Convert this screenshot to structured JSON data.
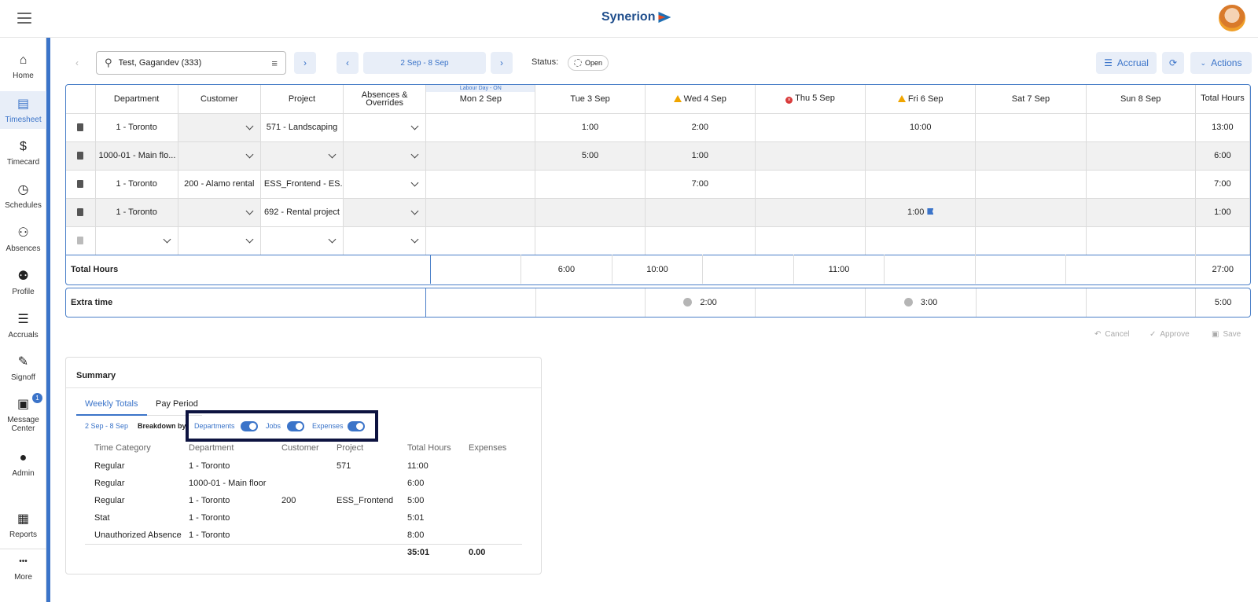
{
  "header": {
    "brand": "Synerion"
  },
  "nav": [
    {
      "label": "Home",
      "icon": "home-icon",
      "glyph": "⌂"
    },
    {
      "label": "Timesheet",
      "icon": "document-icon",
      "glyph": "▤"
    },
    {
      "label": "Timecard",
      "icon": "dollar-icon",
      "glyph": "$"
    },
    {
      "label": "Schedules",
      "icon": "clock-icon",
      "glyph": "◷"
    },
    {
      "label": "Absences",
      "icon": "person-remove-icon",
      "glyph": "⚇"
    },
    {
      "label": "Profile",
      "icon": "people-icon",
      "glyph": "⚉"
    },
    {
      "label": "Accruals",
      "icon": "list-icon",
      "glyph": "☰"
    },
    {
      "label": "Signoff",
      "icon": "signature-icon",
      "glyph": "✎"
    },
    {
      "label1": "Message",
      "label2": "Center",
      "badge": "1",
      "icon": "chat-icon",
      "glyph": "▣"
    },
    {
      "label": "Admin",
      "icon": "person-icon",
      "glyph": "●"
    },
    {
      "label": "Reports",
      "icon": "files-icon",
      "glyph": "▦"
    },
    {
      "label": "More",
      "icon": "more-icon",
      "glyph": "•••"
    }
  ],
  "toolbar": {
    "search_value": "Test, Gagandev (333)",
    "date_range": "2 Sep - 8 Sep",
    "status_label": "Status:",
    "status_value": "Open",
    "accrual": "Accrual",
    "actions": "Actions"
  },
  "grid": {
    "headers": [
      "Department",
      "Customer",
      "Project",
      "Absences & Overrides"
    ],
    "holiday": "Labour Day - ON",
    "days": [
      "Mon 2 Sep",
      "Tue 3 Sep",
      "Wed 4 Sep",
      "Thu 5 Sep",
      "Fri 6 Sep",
      "Sat 7 Sep",
      "Sun 8 Sep"
    ],
    "total_header": "Total Hours",
    "rows": [
      {
        "dept": "1 - Toronto",
        "cust": "",
        "proj": "571 - Landscaping",
        "abs": "",
        "d": [
          "",
          "1:00",
          "2:00",
          "",
          "10:00",
          "",
          ""
        ],
        "total": "13:00"
      },
      {
        "dept": "1000-01 - Main flo...",
        "cust": "",
        "proj": "",
        "abs": "",
        "d": [
          "",
          "5:00",
          "1:00",
          "",
          "",
          "",
          ""
        ],
        "total": "6:00"
      },
      {
        "dept": "1 - Toronto",
        "cust": "200 - Alamo rental",
        "proj": "ESS_Frontend - ES...",
        "abs": "",
        "d": [
          "",
          "",
          "7:00",
          "",
          "",
          "",
          ""
        ],
        "total": "7:00"
      },
      {
        "dept": "1 - Toronto",
        "cust": "",
        "proj": "692 - Rental project",
        "abs": "",
        "d": [
          "",
          "",
          "",
          "",
          "1:00",
          "",
          ""
        ],
        "total": "1:00"
      }
    ],
    "total_row": {
      "label": "Total Hours",
      "d": [
        "",
        "6:00",
        "10:00",
        "",
        "11:00",
        "",
        "",
        ""
      ],
      "total": "27:00"
    },
    "extra_row": {
      "label": "Extra time",
      "wed": "2:00",
      "fri": "3:00",
      "total": "5:00"
    }
  },
  "actions": {
    "cancel": "Cancel",
    "approve": "Approve",
    "save": "Save"
  },
  "summary": {
    "title": "Summary",
    "tabs": [
      "Weekly Totals",
      "Pay Period"
    ],
    "range": "2 Sep - 8 Sep",
    "breakdown": "Breakdown by:",
    "toggles": [
      "Departments",
      "Jobs",
      "Expenses"
    ],
    "columns": [
      "Time Category",
      "Department",
      "Customer",
      "Project",
      "Total Hours",
      "Expenses"
    ],
    "rows": [
      [
        "Regular",
        "1 - Toronto",
        "",
        "571",
        "11:00",
        ""
      ],
      [
        "Regular",
        "1000-01 - Main floor",
        "",
        "",
        "6:00",
        ""
      ],
      [
        "Regular",
        "1 - Toronto",
        "200",
        "ESS_Frontend",
        "5:00",
        ""
      ],
      [
        "Stat",
        "1 - Toronto",
        "",
        "",
        "5:01",
        ""
      ],
      [
        "Unauthorized Absence",
        "1 - Toronto",
        "",
        "",
        "8:00",
        ""
      ]
    ],
    "total_hours": "35:01",
    "total_expenses": "0.00"
  },
  "colors": {
    "accent": "#3b74c9",
    "highlight_border": "#0d1340",
    "warning": "#f0a500",
    "error": "#d93b3b"
  }
}
